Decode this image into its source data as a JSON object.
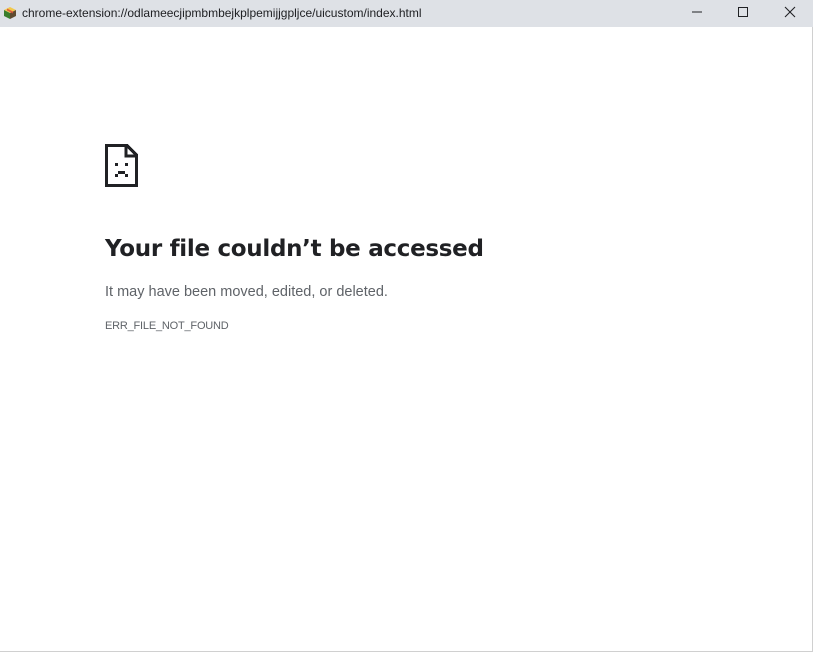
{
  "window": {
    "title_url": "chrome-extension://odlameecjipmbmbejkplpemijjgpljce/uicustom/index.html",
    "app_icon": "extension-cube-icon",
    "controls": {
      "minimize_icon": "minimize-icon",
      "maximize_icon": "maximize-icon",
      "close_icon": "close-icon"
    }
  },
  "error_page": {
    "icon": "sad-file-icon",
    "heading": "Your file couldn’t be accessed",
    "message": "It may have been moved, edited, or deleted.",
    "error_code": "ERR_FILE_NOT_FOUND"
  },
  "colors": {
    "titlebar_bg": "#dee1e6",
    "heading_text": "#202124",
    "secondary_text": "#5f6368"
  }
}
